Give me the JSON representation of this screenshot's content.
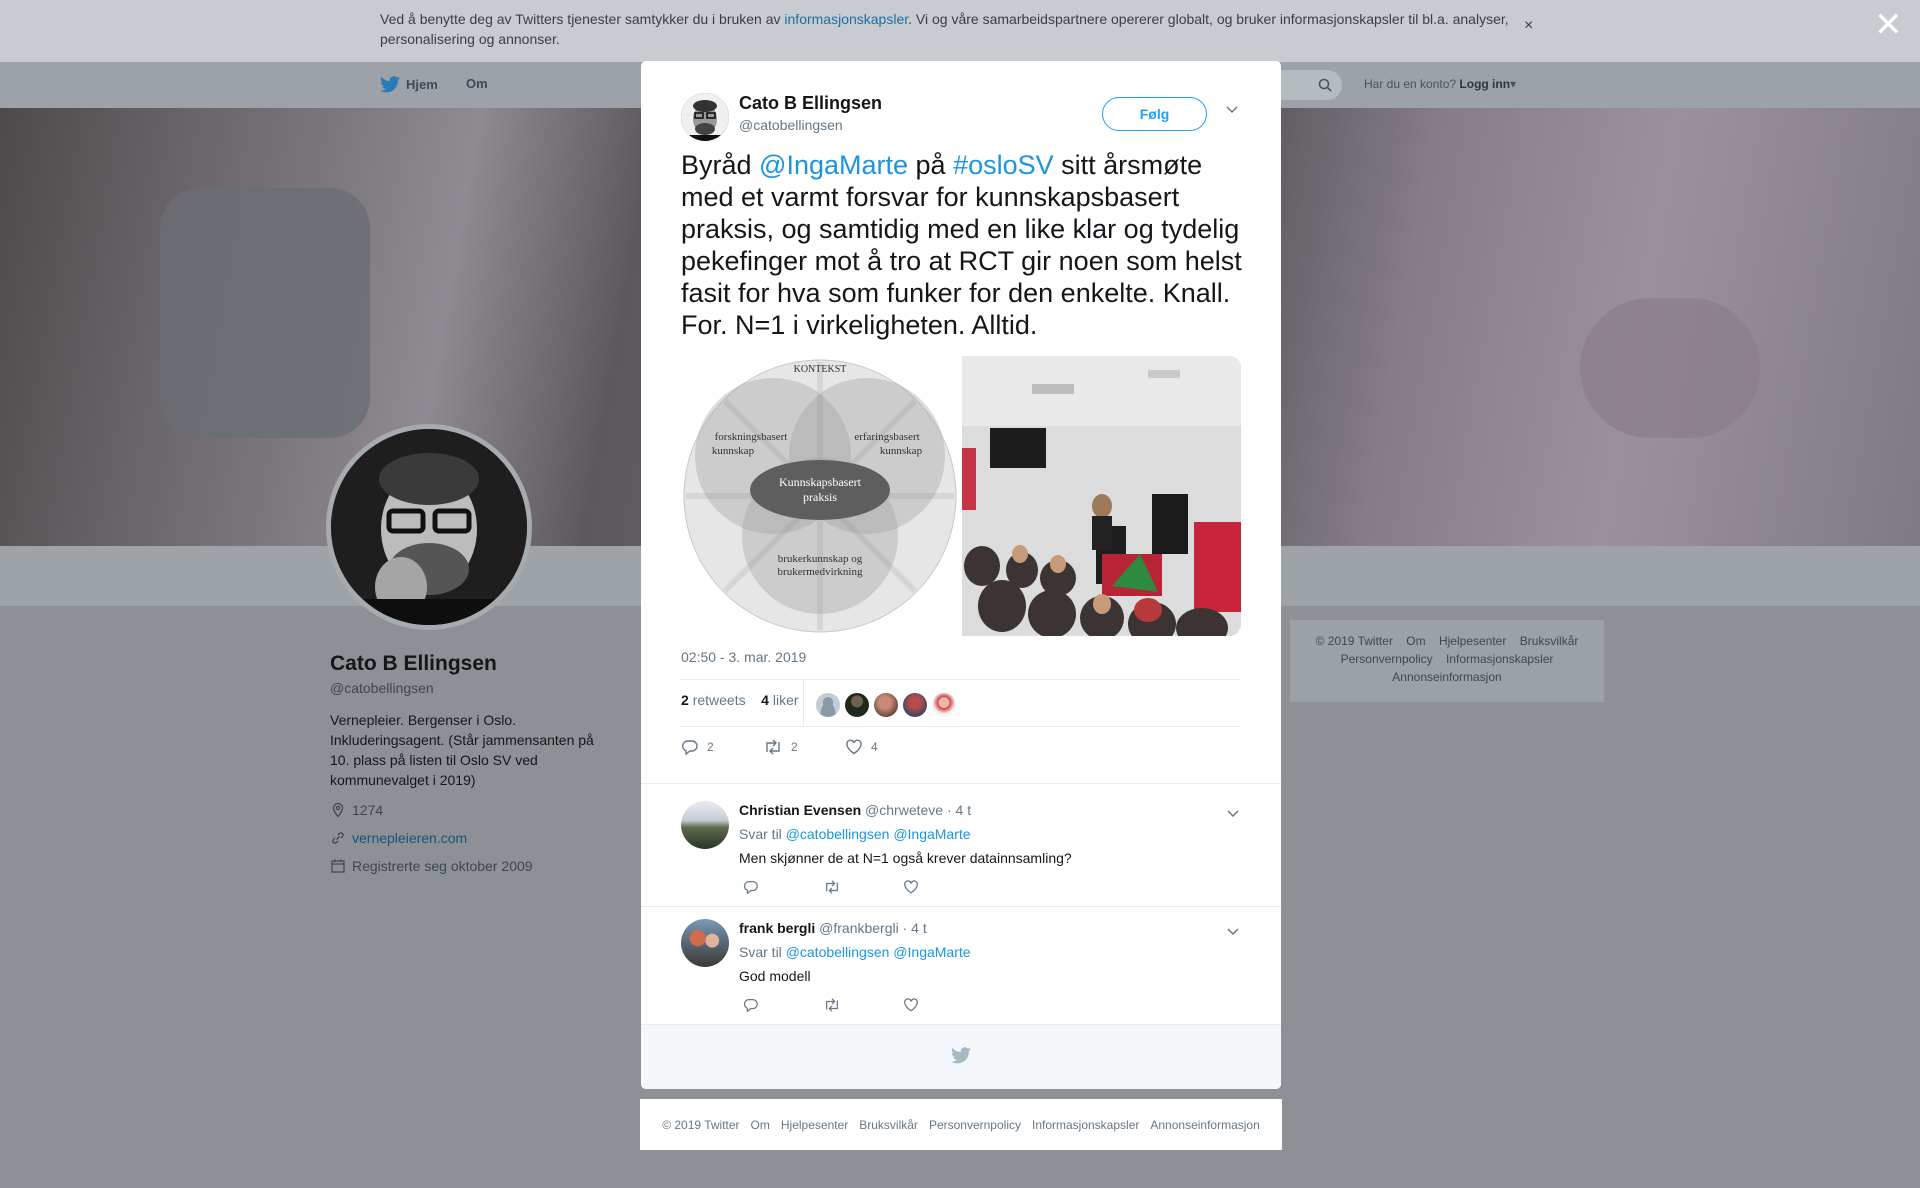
{
  "cookie_banner": {
    "text_before": "Ved å benytte deg av Twitters tjenester samtykker du i bruken av ",
    "link": "informasjonskapsler",
    "text_after": ". Vi og våre samarbeidspartnere opererer globalt, og bruker informasjonskapsler til bl.a. analyser, personalisering og annonser.",
    "close": "×"
  },
  "overlay_close": "✕",
  "nav": {
    "home": "Hjem",
    "about": "Om",
    "have_account": "Har du en konto?",
    "login": "Logg inn"
  },
  "profile": {
    "name": "Cato B Ellingsen",
    "handle": "@catobellingsen",
    "bio": "Vernepleier. Bergenser i Oslo. Inkluderingsagent. (Står jammensanten på 10. plass på listen til Oslo SV ved kommunevalget i 2019)",
    "location": "1274",
    "website": "vernepleieren.com",
    "joined": "Registrerte seg oktober 2009"
  },
  "right_footer": [
    "© 2019 Twitter",
    "Om",
    "Hjelpesenter",
    "Bruksvilkår",
    "Personvernpolicy",
    "Informasjonskapsler",
    "Annonseinformasjon"
  ],
  "tweet": {
    "name": "Cato B Ellingsen",
    "handle": "@catobellingsen",
    "follow": "Følg",
    "text_1": "Byråd ",
    "mention": "@IngaMarte",
    "text_2": " på ",
    "hashtag": "#osloSV",
    "text_3": " sitt årsmøte med et varmt forsvar for kunnskapsbasert praksis, og samtidig med en like klar og tydelig pekefinger mot å tro at RCT gir noen som helst fasit for hva som funker for den enkelte.  Knall. For. N=1 i virkeligheten. Alltid.",
    "diagram": {
      "context": "KONTEKST",
      "research_1": "forskningsbasert",
      "research_2": "kunnskap",
      "experience_1": "erfaringsbasert",
      "experience_2": "kunnskap",
      "center_1": "Kunnskapsbasert",
      "center_2": "praksis",
      "user_1": "brukerkunnskap og",
      "user_2": "brukermedvirkning"
    },
    "time": "02:50 - 3. mar. 2019",
    "retweets_count": "2",
    "retweets_label": "retweets",
    "likes_count": "4",
    "likes_label": "liker",
    "reply_action_count": "2",
    "retweet_action_count": "2",
    "like_action_count": "4"
  },
  "replies": [
    {
      "name": "Christian Evensen",
      "handle": "@chrweteve",
      "time": "· 4 t",
      "reply_to_label": "Svar til ",
      "reply_to_1": "@catobellingsen",
      "reply_to_2": "@IngaMarte",
      "text": "Men skjønner de at N=1 også krever datainnsamling?"
    },
    {
      "name": "frank bergli",
      "handle": "@frankbergli",
      "time": "· 4 t",
      "reply_to_label": "Svar til ",
      "reply_to_1": "@catobellingsen",
      "reply_to_2": "@IngaMarte",
      "text": "God modell"
    }
  ],
  "bottom_footer": [
    "© 2019 Twitter",
    "Om",
    "Hjelpesenter",
    "Bruksvilkår",
    "Personvernpolicy",
    "Informasjonskapsler",
    "Annonseinformasjon"
  ],
  "colors": {
    "accent": "#1da1f2",
    "link": "#1b95e0",
    "secondary_text": "#657786"
  }
}
